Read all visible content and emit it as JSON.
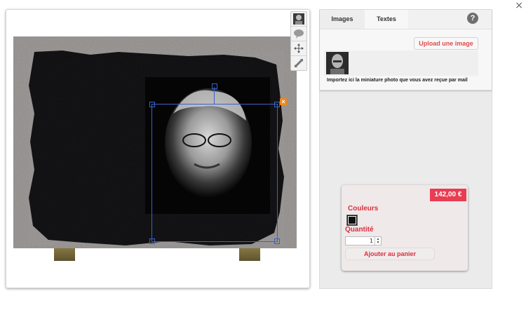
{
  "window": {
    "close_glyph": "×"
  },
  "editor": {
    "toolbar": [
      "avatar-tool",
      "speech-bubble-icon",
      "move-icon",
      "resize-icon"
    ],
    "delete_glyph": "×"
  },
  "side": {
    "tabs": [
      {
        "label": "Images"
      },
      {
        "label": "Textes"
      }
    ],
    "help_glyph": "?",
    "upload_label": "Upload une image",
    "hint": "Importez ici la miniature photo que vous avez reçue par mail"
  },
  "cart": {
    "price": "142,00 €",
    "colors_label": "Couleurs",
    "color_selected": "#111111",
    "quantity_label": "Quantité",
    "quantity_value": "1",
    "add_label": "Ajouter au panier"
  },
  "colors": {
    "accent_red": "#e83d52",
    "selection_blue": "#3a62c9",
    "delete_orange": "#f08a1c"
  }
}
